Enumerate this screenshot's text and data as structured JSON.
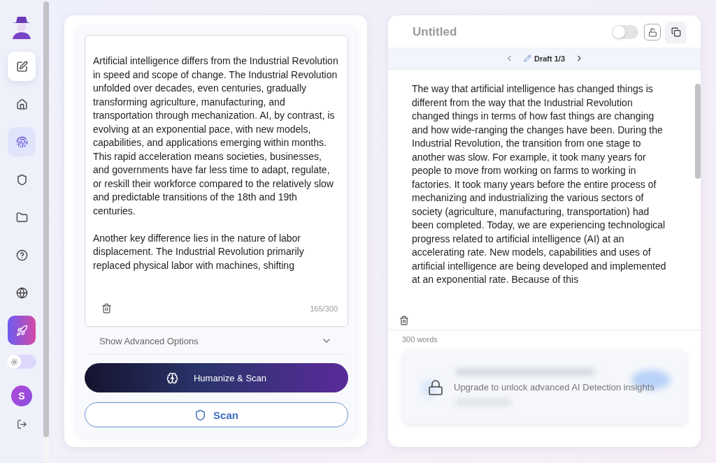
{
  "sidebar": {
    "items": [
      {
        "kind": "compose",
        "selected": false
      },
      {
        "kind": "nav",
        "selected": false
      },
      {
        "kind": "nav",
        "selected": true
      },
      {
        "kind": "nav",
        "selected": false
      },
      {
        "kind": "nav",
        "selected": false
      },
      {
        "kind": "nav",
        "selected": false
      },
      {
        "kind": "nav",
        "selected": false
      },
      {
        "kind": "upgrade",
        "selected": false
      }
    ],
    "dark_mode": false,
    "avatar": "S"
  },
  "editor": {
    "paragraphs": [
      "Artificial intelligence differs from the Industrial Revolution in speed and scope of change. The Industrial Revolution unfolded over decades, even centuries, gradually transforming agriculture, manufacturing, and transportation through mechanization. AI, by contrast, is evolving at an exponential pace, with new models, capabilities, and applications emerging within months. This rapid acceleration means societies, businesses, and governments have far less time to adapt, regulate, or reskill their workforce compared to the relatively slow and predictable transitions of the 18th and 19th centuries.",
      "Another key difference lies in the nature of labor displacement. The Industrial Revolution primarily replaced physical labor with machines, shifting"
    ],
    "counter": "165/300",
    "advanced": {
      "label": "Show Advanced Options",
      "expanded": false
    },
    "buttons": [
      {
        "kind": "primary",
        "label": "Humanize & Scan"
      },
      {
        "kind": "outline",
        "label": "Scan"
      }
    ]
  },
  "output": {
    "title": "Untitled",
    "locked": false,
    "draft": "Draft 1/3",
    "text": "The way that artificial intelligence has changed things is different from the way that the Industrial Revolution changed things in terms of how fast things are changing and how wide-ranging the changes have been. During the Industrial Revolution, the transition from one stage to another was slow. For example, it took many years for people to move from working on farms to working in factories. It took many years before the entire process of mechanizing and industrializing the various sectors of society (agriculture, manufacturing, transportation) had been completed. Today, we are experiencing technological progress related to artificial intelligence (AI) at an accelerating rate. New models, capabilities and uses of artificial intelligence are being developed and implemented at an exponential rate. Because of this",
    "word_count": "300 words",
    "upgrade": "Upgrade to unlock advanced AI Detection insights"
  }
}
